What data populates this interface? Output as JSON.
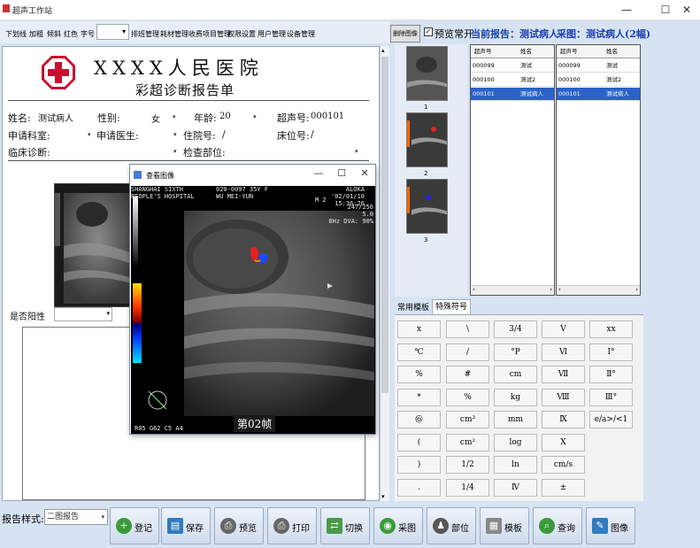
{
  "window": {
    "title": "超声工作站"
  },
  "menu": {
    "items": [
      "下划线",
      "加粗",
      "倾斜",
      "红色",
      "字号",
      "排班管理",
      "耗材管理",
      "收费项目管理",
      "权限设置",
      "用户管理",
      "设备管理"
    ]
  },
  "report": {
    "hospital": "XXXX人民医院",
    "title": "彩超诊断报告单",
    "name_label": "姓名:",
    "name_value": "测试病人",
    "gender_label": "性别:",
    "gender_value": "女",
    "age_label": "年龄:",
    "age_value": "20",
    "us_no_label": "超声号:",
    "us_no_value": "000101",
    "dept_label": "申请科室:",
    "doctor_label": "申请医生:",
    "inpatient_label": "住院号:",
    "inpatient_value": "/",
    "bed_label": "床位号:",
    "bed_value": "/",
    "diag_label": "临床诊断:",
    "exam_label": "检查部位:",
    "positive_label": "是否阳性"
  },
  "viewer": {
    "title": "查看图像",
    "overlay_tl": [
      "SHANGHAI SIXTH",
      "PEOPLE'S HOSPITAL"
    ],
    "overlay_tm": [
      "020-0097 35Y F",
      "WU MEI-YUN"
    ],
    "overlay_tr": [
      "ALOKA",
      "'02/01/10",
      "15:36:26"
    ],
    "overlay_r": [
      "247/256",
      "5.0",
      "8Hz  DVA: 90%"
    ],
    "overlay_m2": "M 2",
    "footer": "R05 G62 C5  A4",
    "frame_label": "第02帧"
  },
  "right": {
    "delete_btn": "删除图像",
    "preview_label": "预览常开",
    "current_report": "当前报告：测试病人",
    "capture_label": "采图：测试病人(2幅)",
    "thumb_nums": [
      "1",
      "2",
      "3"
    ],
    "grid_headers": [
      "超声号",
      "姓名"
    ],
    "grid1_rows": [
      [
        "000099",
        "测试"
      ],
      [
        "000100",
        "测试2"
      ],
      [
        "000101",
        "测试病人"
      ]
    ],
    "grid2_rows": [
      [
        "000099",
        "测试"
      ],
      [
        "000100",
        "测试2"
      ],
      [
        "000101",
        "测试病人"
      ]
    ],
    "tab_common": "常用模板",
    "tab_special": "特殊符号",
    "symbols": [
      "x",
      "\\",
      "3/4",
      "Ⅴ",
      "xx",
      "℃",
      "/",
      "°P",
      "Ⅵ",
      "Ⅰ°",
      "%",
      "#",
      "cm",
      "Ⅶ",
      "Ⅱ°",
      "*",
      "%",
      "kg",
      "Ⅷ",
      "Ⅲ°",
      "@",
      "cm³",
      "mm",
      "Ⅸ",
      "e/a>/<1",
      "(",
      "cm²",
      "log",
      "Ⅹ",
      "",
      ")",
      "1/2",
      "ln",
      "cm/s",
      "",
      ".",
      "1/4",
      "Ⅳ",
      "±",
      ""
    ]
  },
  "bottom": {
    "style_label": "报告样式:",
    "style_value": "二图报告",
    "buttons": [
      "登记",
      "保存",
      "预览",
      "打印",
      "切换",
      "采图",
      "部位",
      "模板",
      "查询",
      "图像"
    ]
  },
  "colors": {
    "accent_blue": "#1a3fb3",
    "selection": "#2a62c8",
    "logo_red": "#c8102e"
  }
}
